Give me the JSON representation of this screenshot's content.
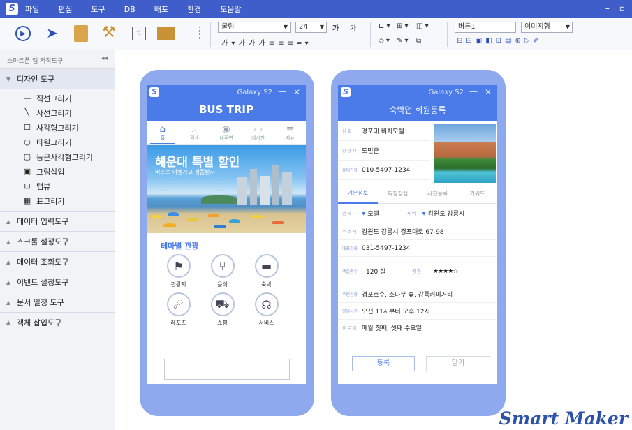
{
  "menubar": {
    "logo": "S",
    "items": [
      "파일",
      "편집",
      "도구",
      "DB",
      "배포",
      "환경",
      "도움말"
    ],
    "min": "–",
    "max": "▫"
  },
  "toolbar": {
    "font_name": "굴림",
    "font_size": "24",
    "btn_text": "버튼1",
    "image_type": "이미지형",
    "format_row": "가 ▾  가  가  가  ≡  ≡  ≡  ═ ▾",
    "grow_a": "가",
    "shrink_a": "가"
  },
  "sidebar": {
    "header": "스마트폰 앱 저작도구",
    "collapse": "◂◂",
    "design_section": "디자인 도구",
    "tools": [
      {
        "icon": "—",
        "label": "직선그리기"
      },
      {
        "icon": "╲",
        "label": "사선그리기"
      },
      {
        "icon": "☐",
        "label": "사각형그리기"
      },
      {
        "icon": "○",
        "label": "타원그리기"
      },
      {
        "icon": "▢",
        "label": "둥근사각형그리기"
      },
      {
        "icon": "▣",
        "label": "그림삽입"
      },
      {
        "icon": "⊡",
        "label": "탭뷰"
      },
      {
        "icon": "▦",
        "label": "표그리기"
      }
    ],
    "sections": [
      "데이터 입력도구",
      "스크롤 설정도구",
      "데이터 조회도구",
      "이벤트 설정도구",
      "문서 일정 도구",
      "객체 삽입도구"
    ]
  },
  "phone1": {
    "logo": "S",
    "device": "Galaxy S2",
    "min": "—",
    "close": "✕",
    "app_title": "BUS TRIP",
    "nav": [
      {
        "icon": "⌂",
        "label": "홈"
      },
      {
        "icon": "⌕",
        "label": "검색"
      },
      {
        "icon": "◉",
        "label": "내주변"
      },
      {
        "icon": "▭",
        "label": "게시판"
      },
      {
        "icon": "≡",
        "label": "메뉴"
      }
    ],
    "banner_title": "해운대 특별 할인",
    "banner_sub": "버스로 여행가고 경품받자!",
    "section_title": "테마별 관광",
    "categories": [
      {
        "icon": "⚑",
        "label": "관광지"
      },
      {
        "icon": "⑂",
        "label": "음식"
      },
      {
        "icon": "▬",
        "label": "숙박"
      },
      {
        "icon": "☄",
        "label": "레포츠"
      },
      {
        "icon": "⛟",
        "label": "쇼핑"
      },
      {
        "icon": "☊",
        "label": "서비스"
      }
    ]
  },
  "phone2": {
    "logo": "S",
    "device": "Galaxy S2",
    "min": "—",
    "close": "✕",
    "page_title": "숙박업 회원등록",
    "info": [
      {
        "key": "상   호",
        "value": "경포대 비치모텔"
      },
      {
        "key": "담 당 자",
        "value": "도민준"
      },
      {
        "key": "휴대전화",
        "value": "010-5497-1234"
      }
    ],
    "tabs": [
      "기본정보",
      "특징장점",
      "사진등록",
      "키워드"
    ],
    "category_key": "업   태",
    "category_value": "모텔",
    "region_key": "지   역",
    "region_value": "강원도 강릉시",
    "address_key": "주 소 지",
    "address_value": "강원도 강릉시 경포대로 67-98",
    "phone_key": "대표전화",
    "phone_value": "031-5497-1234",
    "rooms_key": "객실총수",
    "rooms_value": "120  실",
    "grade_key": "평   점",
    "grade_value": "★★★★☆",
    "nearby_key": "주변관광",
    "nearby_value": "경포호수, 소나무 숲, 강릉커피거리",
    "hours_key": "영업시간",
    "hours_value": "오전 11시부터 오후 12시",
    "holiday_key": "휴 무 일",
    "holiday_value": "매월 첫째, 셋째 수요일",
    "register": "등록",
    "close_btn": "닫기"
  },
  "watermark": "Smart Maker",
  "colors": {
    "accent": "#3f5ec9",
    "phone": "#8fa9ee",
    "app": "#4a7be8"
  }
}
